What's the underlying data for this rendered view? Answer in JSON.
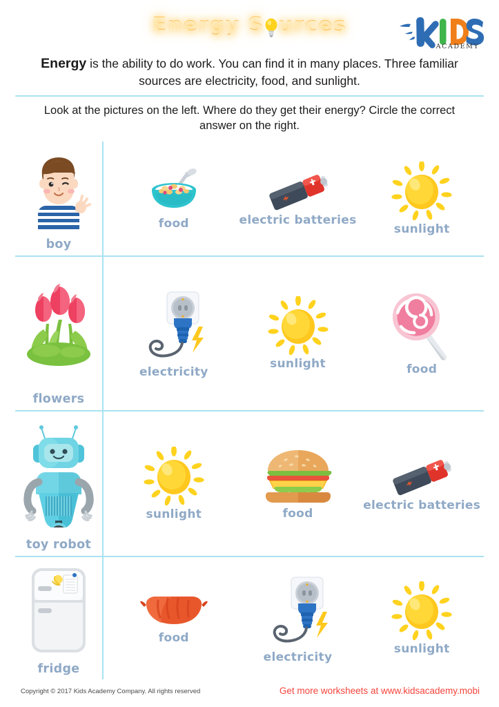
{
  "header": {
    "title_part1": "Energy S",
    "title_bulb_icon": "lightbulb-icon",
    "title_part2": "urces",
    "title_full": "Energy Sources",
    "logo_kids": "KIDS",
    "logo_academy": "ACADEMY"
  },
  "intro": {
    "bold_word": "Energy",
    "text": " is the ability to do work. You can find it in many places. Three familiar sources are electricity, food, and sunlight."
  },
  "instruction": {
    "text": "Look at the pictures on the left. Where do they get their energy? Circle the correct answer on the right."
  },
  "rows": [
    {
      "subject": {
        "label": "boy",
        "icon": "boy-icon"
      },
      "options": [
        {
          "label": "food",
          "icon": "cereal-bowl-icon"
        },
        {
          "label": "electric batteries",
          "icon": "battery-icon"
        },
        {
          "label": "sunlight",
          "icon": "sun-icon"
        }
      ]
    },
    {
      "subject": {
        "label": "flowers",
        "icon": "tulips-icon"
      },
      "options": [
        {
          "label": "electricity",
          "icon": "plug-socket-icon"
        },
        {
          "label": "sunlight",
          "icon": "sun-icon"
        },
        {
          "label": "food",
          "icon": "lollipop-icon"
        }
      ]
    },
    {
      "subject": {
        "label": "toy robot",
        "icon": "robot-icon"
      },
      "options": [
        {
          "label": "sunlight",
          "icon": "sun-icon"
        },
        {
          "label": "food",
          "icon": "burger-icon"
        },
        {
          "label": "electric batteries",
          "icon": "battery-icon"
        }
      ]
    },
    {
      "subject": {
        "label": "fridge",
        "icon": "fridge-icon"
      },
      "options": [
        {
          "label": "food",
          "icon": "sausage-icon"
        },
        {
          "label": "electricity",
          "icon": "plug-socket-icon"
        },
        {
          "label": "sunlight",
          "icon": "sun-icon"
        }
      ]
    }
  ],
  "footer": {
    "copyright": "Copyright © 2017 Kids Academy Company. All rights reserved",
    "promo": "Get more worksheets at www.kidsacademy.mobi"
  },
  "colors": {
    "title_orange": "#FF9A1F",
    "divider_cyan": "#a9e2f2",
    "label_blue": "#8FA9C6",
    "promo_red": "#F4453C",
    "sun_yellow": "#FFD21E",
    "logo_blue": "#2E6DB4"
  }
}
